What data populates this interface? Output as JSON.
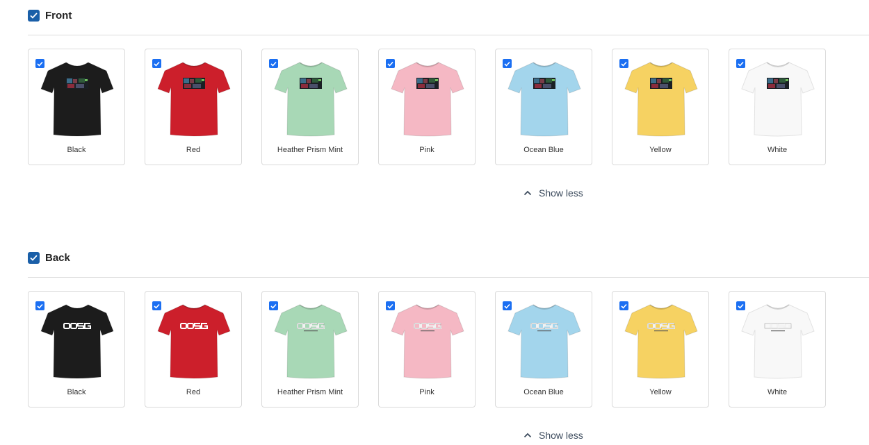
{
  "sections": [
    {
      "title": "Front",
      "show_less_label": "Show less",
      "variants": [
        {
          "label": "Black",
          "color": "#1c1c1c",
          "print": "photo"
        },
        {
          "label": "Red",
          "color": "#cc1f2b",
          "print": "photo"
        },
        {
          "label": "Heather Prism Mint",
          "color": "#a8d8b6",
          "print": "photo"
        },
        {
          "label": "Pink",
          "color": "#f5b8c4",
          "print": "photo"
        },
        {
          "label": "Ocean Blue",
          "color": "#a3d5ec",
          "print": "photo"
        },
        {
          "label": "Yellow",
          "color": "#f6d262",
          "print": "photo"
        },
        {
          "label": "White",
          "color": "#f8f8f8",
          "print": "photo"
        }
      ]
    },
    {
      "title": "Back",
      "show_less_label": "Show less",
      "print_text": "OOSG",
      "variants": [
        {
          "label": "Black",
          "color": "#1c1c1c",
          "print": "logo"
        },
        {
          "label": "Red",
          "color": "#cc1f2b",
          "print": "logo"
        },
        {
          "label": "Heather Prism Mint",
          "color": "#a8d8b6",
          "print": "logo"
        },
        {
          "label": "Pink",
          "color": "#f5b8c4",
          "print": "logo"
        },
        {
          "label": "Ocean Blue",
          "color": "#a3d5ec",
          "print": "logo"
        },
        {
          "label": "Yellow",
          "color": "#f6d262",
          "print": "logo"
        },
        {
          "label": "White",
          "color": "#f8f8f8",
          "print": "logo"
        }
      ]
    }
  ],
  "colors": {
    "section_check": "#1a5fa8",
    "variant_check": "#1b6ff2",
    "border": "#dadada"
  },
  "icons": {
    "section_check": "checkmark-icon",
    "variant_check": "checkmark-icon",
    "show_less": "chevron-up-icon",
    "shirt": "tshirt-icon"
  }
}
